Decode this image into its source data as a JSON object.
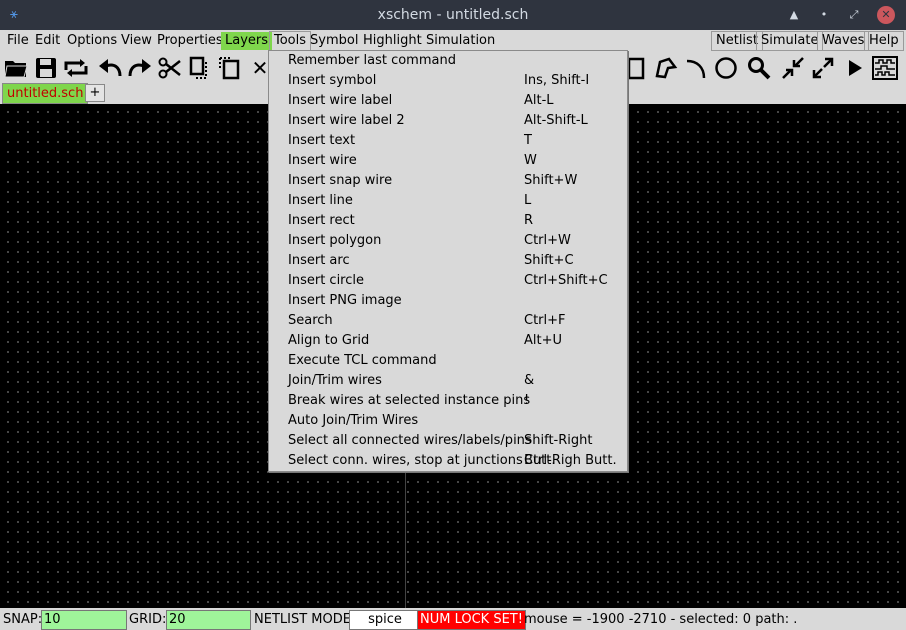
{
  "window": {
    "title": "xschem - untitled.sch"
  },
  "menubar": {
    "items": [
      "File",
      "Edit",
      "Options",
      "View",
      "Properties",
      "Layers",
      "Tools",
      "Symbol",
      "Highlight",
      "Simulation"
    ],
    "right_items": [
      "Netlist",
      "Simulate",
      "Waves",
      "Help"
    ]
  },
  "tabs": {
    "active": "untitled.sch",
    "add_label": "+"
  },
  "tools_menu": [
    {
      "label": "Remember last command",
      "shortcut": ""
    },
    {
      "label": "Insert symbol",
      "shortcut": "Ins, Shift-I"
    },
    {
      "label": "Insert wire label",
      "shortcut": "Alt-L"
    },
    {
      "label": "Insert wire label 2",
      "shortcut": "Alt-Shift-L"
    },
    {
      "label": "Insert text",
      "shortcut": "T"
    },
    {
      "label": "Insert wire",
      "shortcut": "W"
    },
    {
      "label": "Insert snap wire",
      "shortcut": "Shift+W"
    },
    {
      "label": "Insert line",
      "shortcut": "L"
    },
    {
      "label": "Insert rect",
      "shortcut": "R"
    },
    {
      "label": "Insert polygon",
      "shortcut": "Ctrl+W"
    },
    {
      "label": "Insert arc",
      "shortcut": "Shift+C"
    },
    {
      "label": "Insert circle",
      "shortcut": "Ctrl+Shift+C"
    },
    {
      "label": "Insert PNG image",
      "shortcut": ""
    },
    {
      "label": "Search",
      "shortcut": "Ctrl+F"
    },
    {
      "label": "Align to Grid",
      "shortcut": "Alt+U"
    },
    {
      "label": "Execute TCL command",
      "shortcut": ""
    },
    {
      "label": "Join/Trim wires",
      "shortcut": "&"
    },
    {
      "label": "Break wires at selected instance pins",
      "shortcut": "!"
    },
    {
      "label": "Auto Join/Trim Wires",
      "shortcut": ""
    },
    {
      "label": "Select all connected wires/labels/pins",
      "shortcut": "Shift-Right Butt."
    },
    {
      "label": "Select conn. wires, stop at junctions",
      "shortcut": "Ctrl-Righ Butt."
    }
  ],
  "statusbar": {
    "snap_label": "SNAP:",
    "snap_value": "10",
    "grid_label": "GRID:",
    "grid_value": "20",
    "netlist_label": "NETLIST MODE:",
    "netlist_value": "spice",
    "numlock": "NUM LOCK SET!",
    "mouse_info": "mouse = -1900 -2710 - selected: 0 path: ."
  },
  "colors": {
    "accent": "#7fd64c",
    "warning": "#ff0000",
    "titlebar": "#2f343f"
  }
}
